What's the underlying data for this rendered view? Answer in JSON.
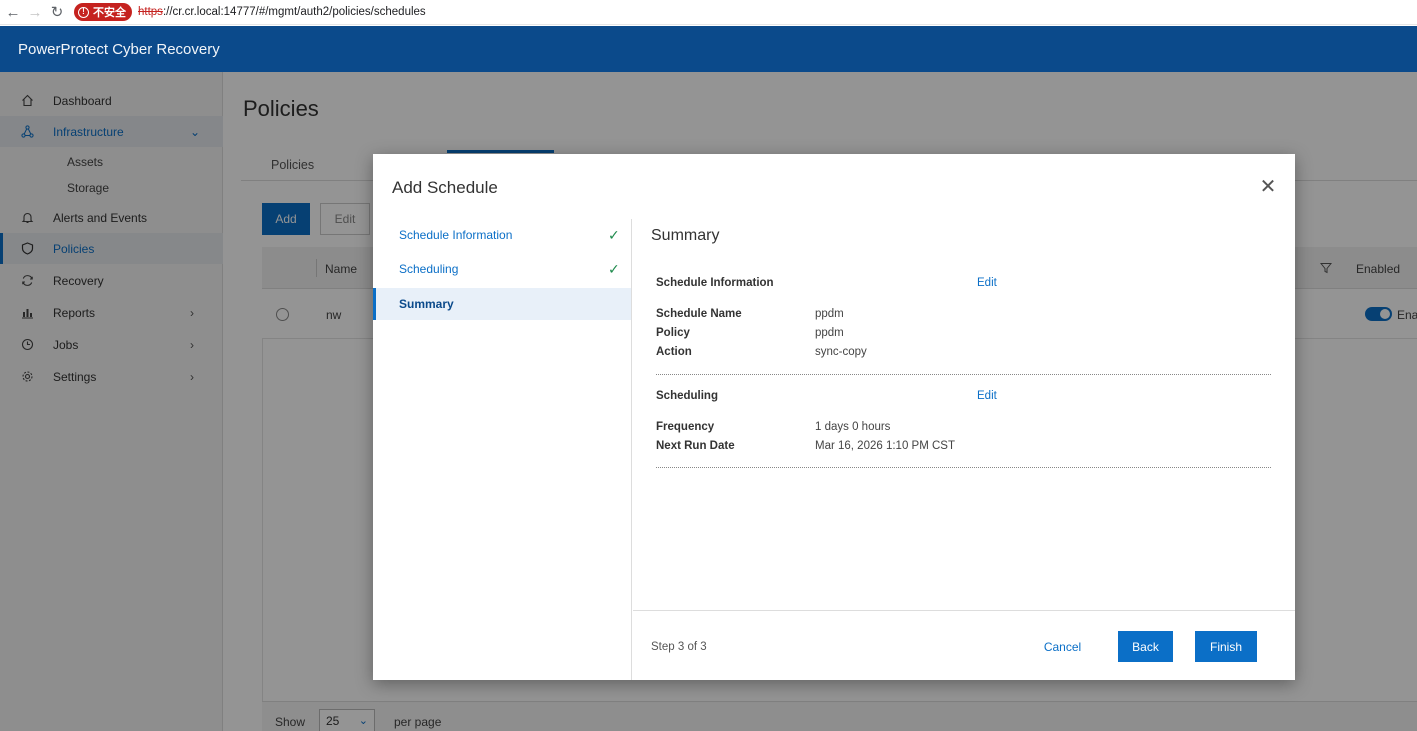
{
  "browser": {
    "security_label": "不安全",
    "url_scheme": "https",
    "url_rest": "://cr.cr.local:14777/#/mgmt/auth2/policies/schedules"
  },
  "app": {
    "title": "PowerProtect Cyber Recovery"
  },
  "sidebar": {
    "items": [
      {
        "label": "Dashboard",
        "icon": "home-icon"
      },
      {
        "label": "Infrastructure",
        "icon": "network-icon",
        "expanded": true
      },
      {
        "label": "Assets"
      },
      {
        "label": "Storage"
      },
      {
        "label": "Alerts and Events",
        "icon": "bell-icon"
      },
      {
        "label": "Policies",
        "icon": "shield-icon",
        "selected": true
      },
      {
        "label": "Recovery",
        "icon": "refresh-icon"
      },
      {
        "label": "Reports",
        "icon": "bar-chart-icon"
      },
      {
        "label": "Jobs",
        "icon": "clock-icon"
      },
      {
        "label": "Settings",
        "icon": "gear-icon"
      }
    ]
  },
  "main": {
    "title": "Policies",
    "tabs": [
      {
        "label": "Policies"
      }
    ],
    "toolbar": {
      "add": "Add",
      "edit": "Edit"
    },
    "table": {
      "headers": {
        "name": "Name",
        "enabled": "Enabled"
      },
      "rows": [
        {
          "name": "nw",
          "enabled_label": "Enal"
        }
      ]
    },
    "pagination": {
      "show": "Show",
      "per_page_value": "25",
      "per_page": "per page"
    }
  },
  "modal": {
    "title": "Add Schedule",
    "steps": [
      {
        "label": "Schedule Information",
        "complete": true
      },
      {
        "label": "Scheduling",
        "complete": true
      },
      {
        "label": "Summary",
        "current": true
      }
    ],
    "summary": {
      "title": "Summary",
      "sections": [
        {
          "title": "Schedule Information",
          "edit": "Edit",
          "fields": [
            {
              "key": "Schedule Name",
              "value": "ppdm"
            },
            {
              "key": "Policy",
              "value": "ppdm"
            },
            {
              "key": "Action",
              "value": "sync-copy"
            }
          ]
        },
        {
          "title": "Scheduling",
          "edit": "Edit",
          "fields": [
            {
              "key": "Frequency",
              "value": "1 days 0 hours"
            },
            {
              "key": "Next Run Date",
              "value": "Mar 16, 2026 1:10 PM CST"
            }
          ]
        }
      ]
    },
    "footer": {
      "step_count": "Step 3 of 3",
      "cancel": "Cancel",
      "back": "Back",
      "finish": "Finish"
    }
  },
  "colors": {
    "accent": "#0b6fc7",
    "header": "#0b4a8b",
    "success": "#1e8a4c"
  }
}
